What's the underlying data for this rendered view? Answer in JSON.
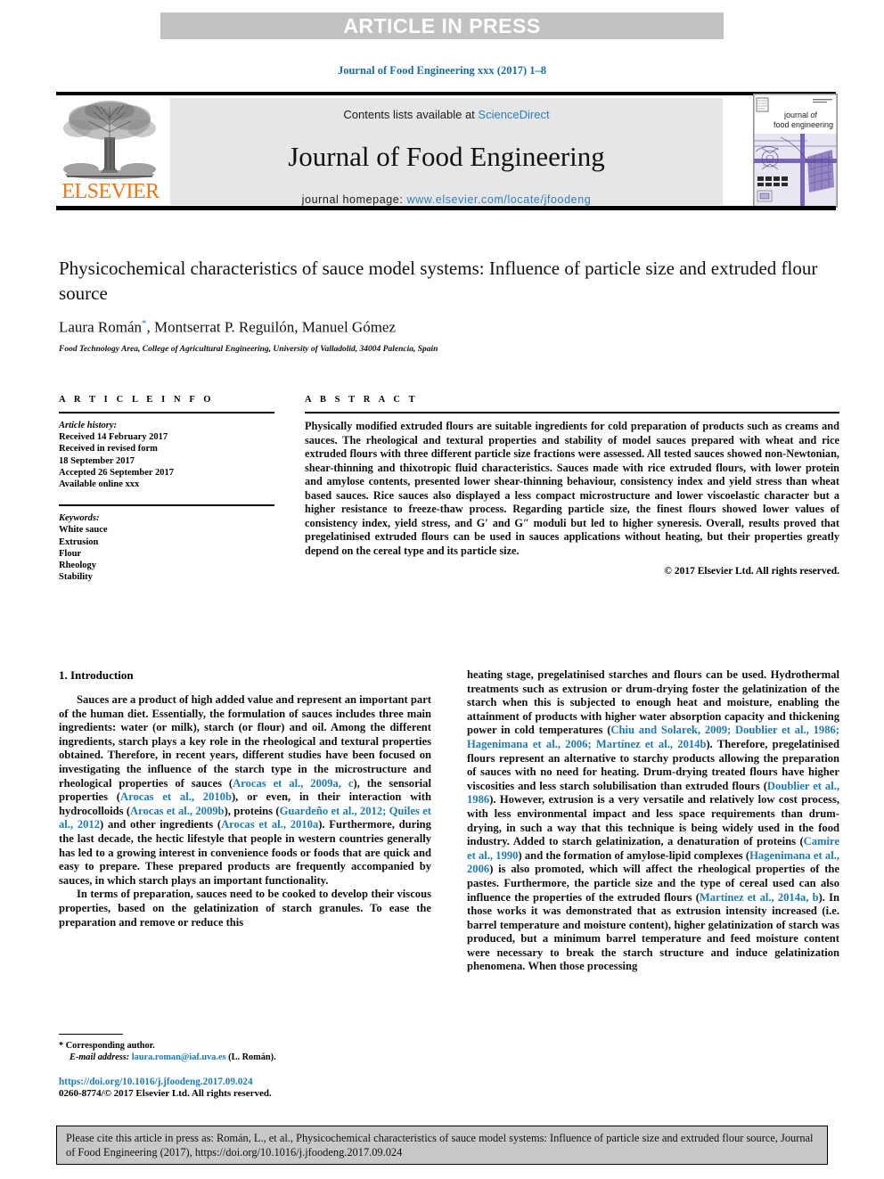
{
  "banner": {
    "text": "ARTICLE IN PRESS"
  },
  "running_head": "Journal of Food Engineering xxx (2017) 1–8",
  "masthead": {
    "publisher_logo_text": "ELSEVIER",
    "contents_prefix": "Contents lists available at ",
    "contents_link": "ScienceDirect",
    "journal_name": "Journal of Food Engineering",
    "homepage_prefix": "journal homepage: ",
    "homepage_link": "www.elsevier.com/locate/jfoodeng",
    "cover_title_line1": "journal of",
    "cover_title_line2": "food engineering"
  },
  "article": {
    "title": "Physicochemical characteristics of sauce model systems: Influence of particle size and extruded flour source",
    "authors": "Laura Román",
    "authors_rest": ", Montserrat P. Reguilón, Manuel Gómez",
    "corresponding_marker": "*",
    "affiliation": "Food Technology Area, College of Agricultural Engineering, University of Valladolid, 34004 Palencia, Spain"
  },
  "article_info": {
    "heading": "A R T I C L E   I N F O",
    "history_label": "Article history:",
    "history": [
      "Received 14 February 2017",
      "Received in revised form",
      "18 September 2017",
      "Accepted 26 September 2017",
      "Available online xxx"
    ],
    "keywords_label": "Keywords:",
    "keywords": [
      "White sauce",
      "Extrusion",
      "Flour",
      "Rheology",
      "Stability"
    ]
  },
  "abstract": {
    "heading": "A B S T R A C T",
    "text": "Physically modified extruded flours are suitable ingredients for cold preparation of products such as creams and sauces. The rheological and textural properties and stability of model sauces prepared with wheat and rice extruded flours with three different particle size fractions were assessed. All tested sauces showed non-Newtonian, shear-thinning and thixotropic fluid characteristics. Sauces made with rice extruded flours, with lower protein and amylose contents, presented lower shear-thinning behaviour, consistency index and yield stress than wheat based sauces. Rice sauces also displayed a less compact microstructure and lower viscoelastic character but a higher resistance to freeze-thaw process. Regarding particle size, the finest flours showed lower values of consistency index, yield stress, and G′ and G″ moduli but led to higher syneresis. Overall, results proved that pregelatinised extruded flours can be used in sauces applications without heating, but their properties greatly depend on the cereal type and its particle size.",
    "copyright": "© 2017 Elsevier Ltd. All rights reserved."
  },
  "body": {
    "section_number_title": "1. Introduction",
    "left_para_1_a": "Sauces are a product of high added value and represent an important part of the human diet. Essentially, the formulation of sauces includes three main ingredients: water (or milk), starch (or flour) and oil. Among the different ingredients, starch plays a key role in the rheological and textural properties obtained. Therefore, in recent years, different studies have been focused on investigating the influence of the starch type in the microstructure and rheological properties of sauces (",
    "left_cite_1": "Arocas et al., 2009a, c",
    "left_para_1_b": "), the sensorial properties (",
    "left_cite_2": "Arocas et al., 2010b",
    "left_para_1_c": "), or even, in their interaction with hydrocolloids (",
    "left_cite_3": "Arocas et al., 2009b",
    "left_para_1_d": "), proteins (",
    "left_cite_4": "Guardeño et al., 2012; Quiles et al., 2012",
    "left_para_1_e": ") and other ingredients (",
    "left_cite_5": "Arocas et al., 2010a",
    "left_para_1_f": "). Furthermore, during the last decade, the hectic lifestyle that people in western countries generally has led to a growing interest in convenience foods or foods that are quick and easy to prepare. These prepared products are frequently accompanied by sauces, in which starch plays an important functionality.",
    "left_para_2": "In terms of preparation, sauces need to be cooked to develop their viscous properties, based on the gelatinization of starch granules. To ease the preparation and remove or reduce this",
    "right_para_1_a": "heating stage, pregelatinised starches and flours can be used. Hydrothermal treatments such as extrusion or drum-drying foster the gelatinization of the starch when this is subjected to enough heat and moisture, enabling the attainment of products with higher water absorption capacity and thickening power in cold temperatures (",
    "right_cite_1": "Chiu and Solarek, 2009; Doublier et al., 1986; Hagenimana et al., 2006; Martínez et al., 2014b",
    "right_para_1_b": "). Therefore, pregelatinised flours represent an alternative to starchy products allowing the preparation of sauces with no need for heating. Drum-drying treated flours have higher viscosities and less starch solubilisation than extruded flours (",
    "right_cite_2": "Doublier et al., 1986",
    "right_para_1_c": "). However, extrusion is a very versatile and relatively low cost process, with less environmental impact and less space requirements than drum-drying, in such a way that this technique is being widely used in the food industry. Added to starch gelatinization, a denaturation of proteins (",
    "right_cite_3": "Camire et al., 1990",
    "right_para_1_d": ") and the formation of amylose-lipid complexes (",
    "right_cite_4": "Hagenimana et al., 2006",
    "right_para_1_e": ") is also promoted, which will affect the rheological properties of the pastes. Furthermore, the particle size and the type of cereal used can also influence the properties of the extruded flours (",
    "right_cite_5": "Martínez et al., 2014a, b",
    "right_para_1_f": "). In those works it was demonstrated that as extrusion intensity increased (i.e. barrel temperature and moisture content), higher gelatinization of starch was produced, but a minimum barrel temperature and feed moisture content were necessary to break the starch structure and induce gelatinization phenomena. When those processing"
  },
  "footnote": {
    "marker": "*",
    "corresponding": "Corresponding author.",
    "email_label": "E-mail address:",
    "email": "laura.roman@iaf.uva.es",
    "email_owner": "(L. Román)."
  },
  "footer": {
    "doi": "https://doi.org/10.1016/j.jfoodeng.2017.09.024",
    "issn_copyright": "0260-8774/© 2017 Elsevier Ltd. All rights reserved."
  },
  "cite_box": {
    "text": "Please cite this article in press as: Román, L., et al., Physicochemical characteristics of sauce model systems: Influence of particle size and extruded flour source, Journal of Food Engineering (2017), https://doi.org/10.1016/j.jfoodeng.2017.09.024"
  },
  "colors": {
    "link_blue": "#1f7bb6",
    "elsevier_orange": "#e8761a",
    "banner_gray": "#c2c2c2",
    "contents_gray": "#e6e6e6",
    "cite_box_gray": "#c8c8c8"
  }
}
